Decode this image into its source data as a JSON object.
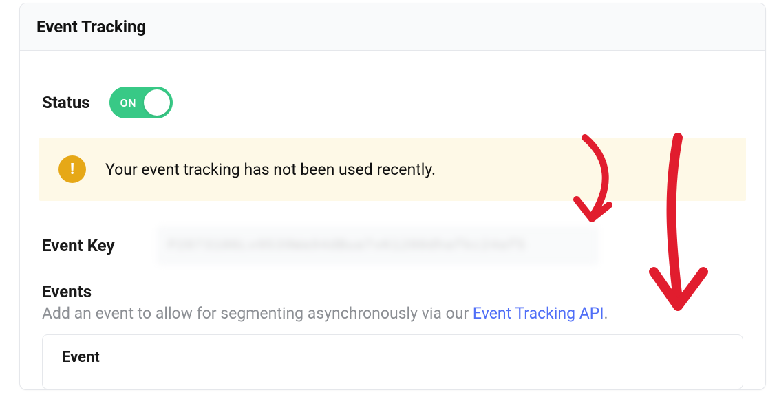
{
  "panel": {
    "title": "Event Tracking"
  },
  "status": {
    "label": "Status",
    "toggle_text": "ON",
    "on": true
  },
  "notice": {
    "text": "Your event tracking has not been used recently."
  },
  "event_key": {
    "label": "Event Key",
    "value_redacted": "P2073106Lv9539Wa94dBuaTvK1280dhafkc24af5"
  },
  "events": {
    "title": "Events",
    "description_prefix": "Add an event to allow for segmenting asynchronously via our ",
    "link_text": "Event Tracking API",
    "description_suffix": ".",
    "table": {
      "header": "Event"
    }
  }
}
